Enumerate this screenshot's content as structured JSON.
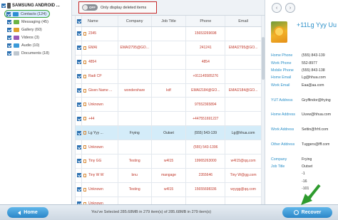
{
  "sidebar": {
    "device": "SAMSUNG ANDROID ...",
    "categories": [
      {
        "label": "Contacts (124)",
        "color": "#2e8fd3"
      },
      {
        "label": "Messaging (45)",
        "color": "#6cb545"
      },
      {
        "label": "Gallery (60)",
        "color": "#e0a12a"
      },
      {
        "label": "Videos (3)",
        "color": "#9b59b6"
      },
      {
        "label": "Audio (10)",
        "color": "#3a9ad9"
      },
      {
        "label": "Documents (18)",
        "color": "#bfc7cf"
      }
    ]
  },
  "toolbar": {
    "toggle_state": "OFF",
    "toggle_label": "Only display deleted items"
  },
  "table": {
    "headers": {
      "name": "Name",
      "company": "Company",
      "job": "Job Title",
      "phone": "Phone",
      "email": "Email"
    },
    "rows": [
      {
        "name": "2345",
        "company": "",
        "job": "",
        "phone": "15653269698",
        "email": ""
      },
      {
        "name": "EMAI",
        "company": "EMAI2795@GO...",
        "job": "",
        "phone": "241241",
        "email": "EMAI2795@GO..."
      },
      {
        "name": "4854",
        "company": "",
        "job": "",
        "phone": "4854",
        "email": ""
      },
      {
        "name": "Radi CP",
        "company": "",
        "job": "",
        "phone": "+911145585276",
        "email": ""
      },
      {
        "name": "Given Name ...",
        "company": "wondershare",
        "job": "kdf",
        "phone": "EMAI2184@GO...",
        "email": "EMAI2184@GO..."
      },
      {
        "name": "Unknown",
        "company": "",
        "job": "",
        "phone": "97552365894",
        "email": ""
      },
      {
        "name": "+44",
        "company": "",
        "job": "",
        "phone": "+447551691227",
        "email": ""
      },
      {
        "name": "Lg Yyy ...",
        "company": "Frying",
        "job": "Outset",
        "phone": "(555) 543-139",
        "email": "Lg@hhua.com"
      },
      {
        "name": "Unknown",
        "company": "",
        "job": "",
        "phone": "(555) 543-1396",
        "email": ""
      },
      {
        "name": "Tiny GG",
        "company": "Testing",
        "job": "w4I15",
        "phone": "19965263000",
        "email": "w4I15@qq.com"
      },
      {
        "name": "Tiny W W",
        "company": "bnu",
        "job": "mangage",
        "phone": "2355646",
        "email": "Tiny W@gg.com"
      },
      {
        "name": "Unknown",
        "company": "Testing",
        "job": "w4I15",
        "phone": "15655698336",
        "email": "wyygg@qq.com"
      },
      {
        "name": "Unknown",
        "company": "",
        "job": "",
        "phone": "",
        "email": ""
      }
    ],
    "selected_index": 7
  },
  "detail": {
    "name": "+11Lg Yyy Uu",
    "fields": [
      {
        "label": "Home Phone",
        "value": "(555) 843-139"
      },
      {
        "label": "Work Phone",
        "value": "552-8977"
      },
      {
        "label": "Mobile Phone",
        "value": "(555) 843-138"
      },
      {
        "label": "Home Email",
        "value": "Lg@hhua.com"
      },
      {
        "label": "Work Email",
        "value": "Eaa@aa.com"
      },
      {
        "label": "",
        "value": ""
      },
      {
        "label": "YUT Address",
        "value": "Gryffindor@frying"
      },
      {
        "label": "",
        "value": ""
      },
      {
        "label": "Home Address",
        "value": "Uuvw@hhua.com"
      },
      {
        "label": "",
        "value": ""
      },
      {
        "label": "Work Address",
        "value": "Settin@frhf.com"
      },
      {
        "label": "",
        "value": ""
      },
      {
        "label": "Other Address",
        "value": "Tuggers@fff.com"
      },
      {
        "label": "",
        "value": ""
      },
      {
        "label": "Company",
        "value": "Frying"
      },
      {
        "label": "Job Title",
        "value": "Outset"
      },
      {
        "label": "",
        "value": "-1"
      },
      {
        "label": "",
        "value": "-16"
      },
      {
        "label": "",
        "value": "-101"
      }
    ]
  },
  "bottom": {
    "home_label": "Home",
    "status": "You've Selected 285.68MB in 279 item(s) of 285.68MB in 279 item(s)",
    "recover_label": "Recover"
  }
}
